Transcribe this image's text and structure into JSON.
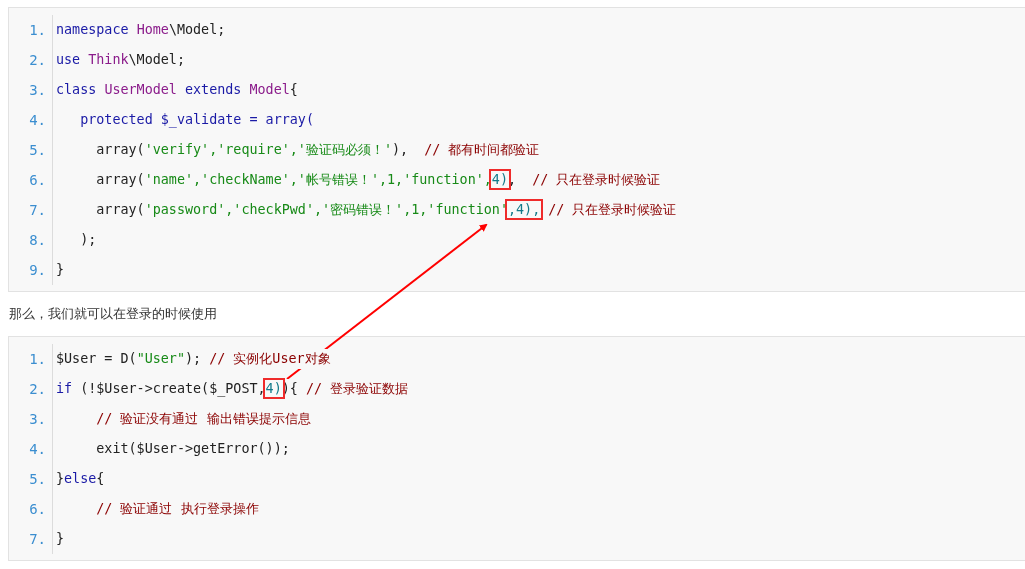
{
  "blocks": [
    {
      "kind": "code",
      "lines": [
        {
          "number": "1.",
          "tokens": [
            {
              "kind": "kw",
              "text": "namespace "
            },
            {
              "kind": "cls",
              "text": "Home"
            },
            {
              "kind": "plain",
              "text": "\\Model;"
            }
          ]
        },
        {
          "number": "2.",
          "tokens": [
            {
              "kind": "kw",
              "text": "use "
            },
            {
              "kind": "cls",
              "text": "Think"
            },
            {
              "kind": "plain",
              "text": "\\Model;"
            }
          ]
        },
        {
          "number": "3.",
          "tokens": [
            {
              "kind": "kw",
              "text": "class "
            },
            {
              "kind": "cls",
              "text": "UserModel"
            },
            {
              "kind": "kw",
              "text": " extends "
            },
            {
              "kind": "cls",
              "text": "Model"
            },
            {
              "kind": "plain",
              "text": "{"
            }
          ]
        },
        {
          "number": "4.",
          "tokens": [
            {
              "kind": "kw",
              "text": "   protected $_validate = array("
            }
          ]
        },
        {
          "number": "5.",
          "tokens": [
            {
              "kind": "plain",
              "text": "     array("
            },
            {
              "kind": "str",
              "text": "'verify','require','验证码必须！'"
            },
            {
              "kind": "plain",
              "text": "),  "
            },
            {
              "kind": "cmt",
              "text": "// 都有时间都验证"
            }
          ]
        },
        {
          "number": "6.",
          "tokens": [
            {
              "kind": "plain",
              "text": "     array("
            },
            {
              "kind": "str",
              "text": "'name','checkName','帐号错误！',1,'function',"
            },
            {
              "kind": "num",
              "text": "4)",
              "boxed": true
            },
            {
              "kind": "plain",
              "text": ",  "
            },
            {
              "kind": "cmt",
              "text": "// 只在登录时候验证"
            }
          ]
        },
        {
          "number": "7.",
          "tokens": [
            {
              "kind": "plain",
              "text": "     array("
            },
            {
              "kind": "str",
              "text": "'password','checkPwd','密码错误！',1,'function'"
            },
            {
              "kind": "num",
              "text": ",4),",
              "boxed": true
            },
            {
              "kind": "cmt",
              "text": " // 只在登录时候验证"
            }
          ]
        },
        {
          "number": "8.",
          "tokens": [
            {
              "kind": "plain",
              "text": "   );"
            }
          ]
        },
        {
          "number": "9.",
          "tokens": [
            {
              "kind": "plain",
              "text": "}"
            }
          ]
        }
      ]
    },
    {
      "kind": "text",
      "text": "那么，我们就可以在登录的时候使用"
    },
    {
      "kind": "code",
      "lines": [
        {
          "number": "1.",
          "tokens": [
            {
              "kind": "plain",
              "text": "$User = D("
            },
            {
              "kind": "str",
              "text": "\"User\""
            },
            {
              "kind": "plain",
              "text": "); "
            },
            {
              "kind": "cmt",
              "text": "// 实例化User对象"
            }
          ]
        },
        {
          "number": "2.",
          "tokens": [
            {
              "kind": "kw",
              "text": "if"
            },
            {
              "kind": "plain",
              "text": " (!$User->create($_POST,"
            },
            {
              "kind": "num",
              "text": "4)",
              "boxed": true
            },
            {
              "kind": "plain",
              "text": "){ "
            },
            {
              "kind": "cmt",
              "text": "// 登录验证数据"
            }
          ]
        },
        {
          "number": "3.",
          "tokens": [
            {
              "kind": "cmt",
              "text": "     // 验证没有通过 输出错误提示信息"
            }
          ]
        },
        {
          "number": "4.",
          "tokens": [
            {
              "kind": "plain",
              "text": "     exit($User->getError());"
            }
          ]
        },
        {
          "number": "5.",
          "tokens": [
            {
              "kind": "plain",
              "text": "}"
            },
            {
              "kind": "kw",
              "text": "else"
            },
            {
              "kind": "plain",
              "text": "{"
            }
          ]
        },
        {
          "number": "6.",
          "tokens": [
            {
              "kind": "cmt",
              "text": "     // 验证通过 执行登录操作"
            }
          ]
        },
        {
          "number": "7.",
          "tokens": [
            {
              "kind": "plain",
              "text": "}"
            }
          ]
        }
      ]
    }
  ]
}
